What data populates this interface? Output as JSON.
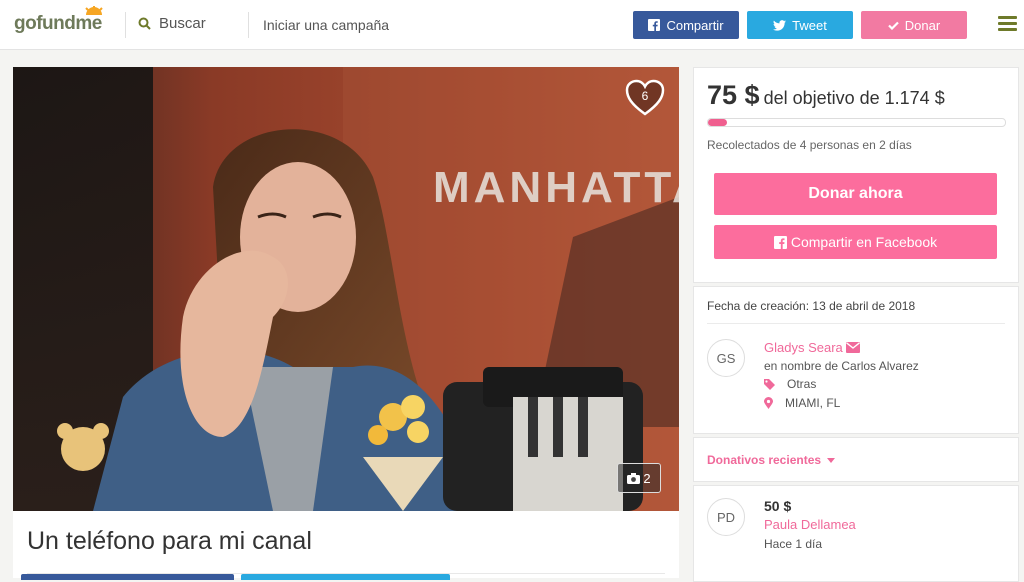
{
  "header": {
    "logo": "gofundme",
    "search_label": "Buscar",
    "start_campaign": "Iniciar una campaña",
    "share_label": "Compartir",
    "tweet_label": "Tweet",
    "donate_label": "Donar"
  },
  "hero": {
    "likes": "6",
    "photo_count": "2",
    "sign_text": "MANHATTA"
  },
  "campaign": {
    "title": "Un teléfono para mi canal"
  },
  "goal": {
    "raised": "75 $",
    "goal_text": "del objetivo de 1.174 $",
    "progress_fraction": 0.064,
    "raised_summary": "Recolectados de 4 personas en 2 días",
    "donate_now": "Donar ahora",
    "share_facebook": "Compartir en Facebook"
  },
  "info": {
    "created": "Fecha de creación: 13 de abril de 2018",
    "organizer_initials": "GS",
    "organizer_name": "Gladys Seara",
    "on_behalf": "en nombre de Carlos Alvarez",
    "category": "Otras",
    "location": "MIAMI, FL"
  },
  "donations": {
    "heading": "Donativos recientes",
    "items": [
      {
        "initials": "PD",
        "amount": "50 $",
        "name": "Paula Dellamea",
        "time": "Hace 1 día"
      }
    ]
  },
  "colors": {
    "facebook": "#37599b",
    "twitter": "#29a9e0",
    "pink": "#fc6d9d",
    "brand_green": "#6e7a2a"
  },
  "icons": [
    "search-icon",
    "facebook-icon",
    "twitter-icon",
    "check-icon",
    "menu-icon",
    "heart-icon",
    "camera-icon",
    "envelope-icon",
    "tag-icon",
    "location-pin-icon",
    "caret-down-icon"
  ]
}
